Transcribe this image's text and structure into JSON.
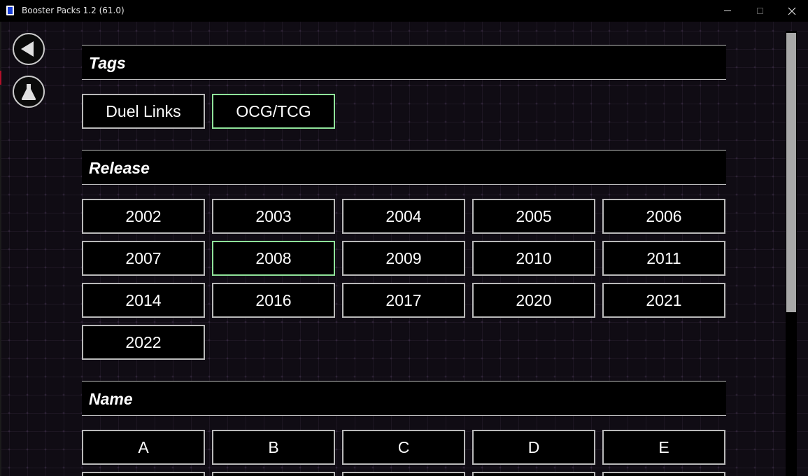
{
  "window": {
    "title": "Booster Packs 1.2 (61.0)",
    "minimize": "—",
    "maximize": "☐",
    "close": "✕"
  },
  "sections": {
    "tags": {
      "title": "Tags",
      "items": [
        {
          "label": "Duel Links",
          "active": false
        },
        {
          "label": "OCG/TCG",
          "active": true
        }
      ]
    },
    "release": {
      "title": "Release",
      "items": [
        {
          "label": "2002",
          "active": false
        },
        {
          "label": "2003",
          "active": false
        },
        {
          "label": "2004",
          "active": false
        },
        {
          "label": "2005",
          "active": false
        },
        {
          "label": "2006",
          "active": false
        },
        {
          "label": "2007",
          "active": false
        },
        {
          "label": "2008",
          "active": true
        },
        {
          "label": "2009",
          "active": false
        },
        {
          "label": "2010",
          "active": false
        },
        {
          "label": "2011",
          "active": false
        },
        {
          "label": "2014",
          "active": false
        },
        {
          "label": "2016",
          "active": false
        },
        {
          "label": "2017",
          "active": false
        },
        {
          "label": "2020",
          "active": false
        },
        {
          "label": "2021",
          "active": false
        },
        {
          "label": "2022",
          "active": false
        }
      ]
    },
    "name": {
      "title": "Name",
      "items": [
        {
          "label": "A",
          "active": false
        },
        {
          "label": "B",
          "active": false
        },
        {
          "label": "C",
          "active": false
        },
        {
          "label": "D",
          "active": false
        },
        {
          "label": "E",
          "active": false
        }
      ]
    }
  },
  "icons": {
    "back": "back-arrow-icon",
    "filter": "flask-icon"
  },
  "colors": {
    "active_border": "#8fe29a",
    "chip_border": "#b9b9b9",
    "background": "#100c14"
  }
}
